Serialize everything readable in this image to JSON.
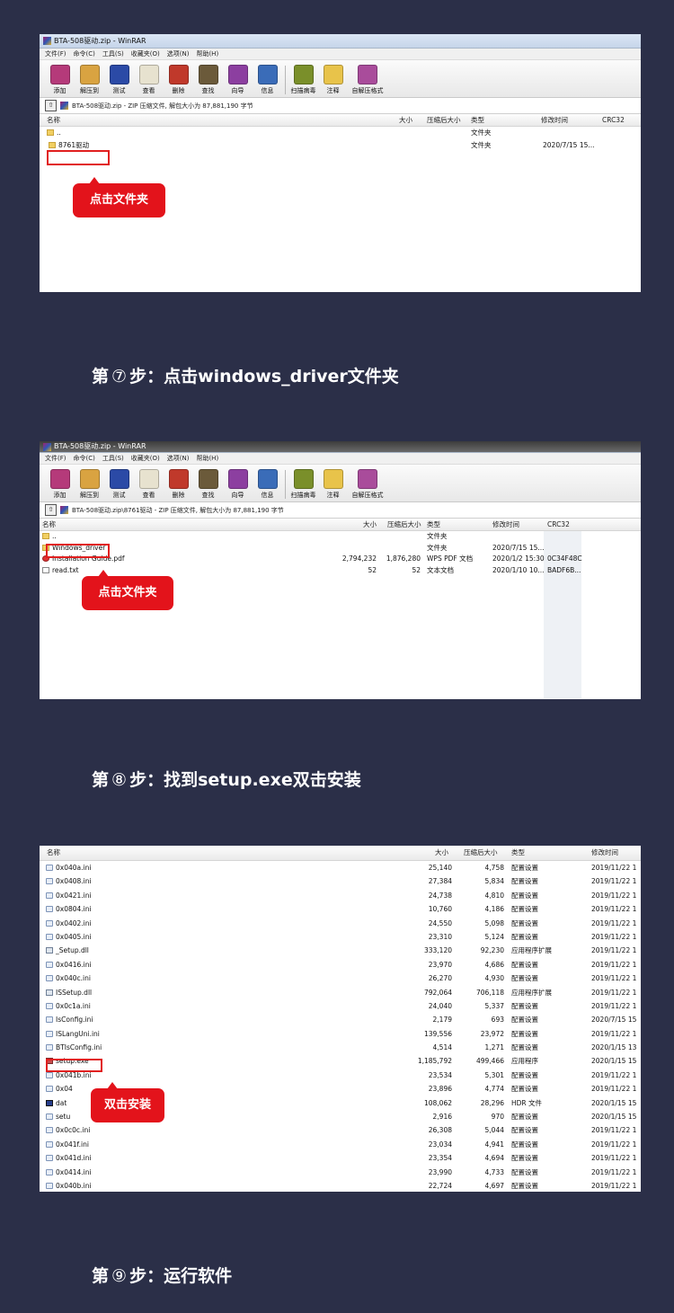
{
  "shot1": {
    "title": "BTA-508驱动.zip - WinRAR",
    "menu": [
      "文件(F)",
      "命令(C)",
      "工具(S)",
      "收藏夹(O)",
      "选项(N)",
      "帮助(H)"
    ],
    "toolbar": [
      "添加",
      "解压到",
      "测试",
      "查看",
      "删除",
      "查找",
      "向导",
      "信息",
      "扫描病毒",
      "注释",
      "自解压格式"
    ],
    "address": "BTA-508驱动.zip - ZIP 压缩文件, 解包大小为 87,881,190 字节",
    "columns": {
      "name": "名称",
      "size": "大小",
      "packed": "压缩后大小",
      "type": "类型",
      "modified": "修改时间",
      "crc": "CRC32"
    },
    "rows": [
      {
        "name": "..",
        "type": "文件夹",
        "modified": ""
      },
      {
        "name": "8761驱动",
        "type": "文件夹",
        "modified": "2020/7/15 15..."
      }
    ],
    "callout": "点击文件夹"
  },
  "step7": {
    "prefix": "第",
    "num": "⑦",
    "text": "步：点击windows_driver文件夹"
  },
  "shot2": {
    "title": "BTA-508驱动.zip - WinRAR",
    "menu": [
      "文件(F)",
      "命令(C)",
      "工具(S)",
      "收藏夹(O)",
      "选项(N)",
      "帮助(H)"
    ],
    "toolbar": [
      "添加",
      "解压到",
      "测试",
      "查看",
      "删除",
      "查找",
      "向导",
      "信息",
      "扫描病毒",
      "注释",
      "自解压格式"
    ],
    "address": "BTA-508驱动.zip\\8761驱动 - ZIP 压缩文件, 解包大小为 87,881,190 字节",
    "columns": {
      "name": "名称",
      "size": "大小",
      "packed": "压缩后大小",
      "type": "类型",
      "modified": "修改时间",
      "crc": "CRC32"
    },
    "rows": [
      {
        "name": "..",
        "size": "",
        "packed": "",
        "type": "文件夹",
        "modified": "",
        "crc": ""
      },
      {
        "name": "Windows_driver",
        "size": "",
        "packed": "",
        "type": "文件夹",
        "modified": "2020/7/15 15...",
        "crc": ""
      },
      {
        "name": "Installation Guide.pdf",
        "size": "2,794,232",
        "packed": "1,876,280",
        "type": "WPS PDF 文档",
        "modified": "2020/1/2 15:30",
        "crc": "0C34F48C"
      },
      {
        "name": "read.txt",
        "size": "52",
        "packed": "52",
        "type": "文本文档",
        "modified": "2020/1/10 10...",
        "crc": "BADF6B..."
      }
    ],
    "callout": "点击文件夹"
  },
  "step8": {
    "prefix": "第",
    "num": "⑧",
    "text": "步：找到setup.exe双击安装"
  },
  "shot3": {
    "columns": {
      "name": "名称",
      "size": "大小",
      "packed": "压缩后大小",
      "type": "类型",
      "modified": "修改时间"
    },
    "rows": [
      {
        "name": "0x040a.ini",
        "size": "25,140",
        "packed": "4,758",
        "type": "配置设置",
        "modified": "2019/11/22 1",
        "icon": "ini"
      },
      {
        "name": "0x0408.ini",
        "size": "27,384",
        "packed": "5,834",
        "type": "配置设置",
        "modified": "2019/11/22 1",
        "icon": "ini"
      },
      {
        "name": "0x0421.ini",
        "size": "24,738",
        "packed": "4,810",
        "type": "配置设置",
        "modified": "2019/11/22 1",
        "icon": "ini"
      },
      {
        "name": "0x0804.ini",
        "size": "10,760",
        "packed": "4,186",
        "type": "配置设置",
        "modified": "2019/11/22 1",
        "icon": "ini"
      },
      {
        "name": "0x0402.ini",
        "size": "24,550",
        "packed": "5,098",
        "type": "配置设置",
        "modified": "2019/11/22 1",
        "icon": "ini"
      },
      {
        "name": "0x0405.ini",
        "size": "23,310",
        "packed": "5,124",
        "type": "配置设置",
        "modified": "2019/11/22 1",
        "icon": "ini"
      },
      {
        "name": "_Setup.dll",
        "size": "333,120",
        "packed": "92,230",
        "type": "应用程序扩展",
        "modified": "2019/11/22 1",
        "icon": "dll"
      },
      {
        "name": "0x0416.ini",
        "size": "23,970",
        "packed": "4,686",
        "type": "配置设置",
        "modified": "2019/11/22 1",
        "icon": "ini"
      },
      {
        "name": "0x040c.ini",
        "size": "26,270",
        "packed": "4,930",
        "type": "配置设置",
        "modified": "2019/11/22 1",
        "icon": "ini"
      },
      {
        "name": "ISSetup.dll",
        "size": "792,064",
        "packed": "706,118",
        "type": "应用程序扩展",
        "modified": "2019/11/22 1",
        "icon": "dll"
      },
      {
        "name": "0x0c1a.ini",
        "size": "24,040",
        "packed": "5,337",
        "type": "配置设置",
        "modified": "2019/11/22 1",
        "icon": "ini"
      },
      {
        "name": "IsConfig.ini",
        "size": "2,179",
        "packed": "693",
        "type": "配置设置",
        "modified": "2020/7/15 15",
        "icon": "ini"
      },
      {
        "name": "ISLangUni.ini",
        "size": "139,556",
        "packed": "23,972",
        "type": "配置设置",
        "modified": "2019/11/22 1",
        "icon": "ini"
      },
      {
        "name": "BTIsConfig.ini",
        "size": "4,514",
        "packed": "1,271",
        "type": "配置设置",
        "modified": "2020/1/15 13",
        "icon": "ini"
      },
      {
        "name": "setup.exe",
        "size": "1,185,792",
        "packed": "499,466",
        "type": "应用程序",
        "modified": "2020/1/15 15",
        "icon": "exe"
      },
      {
        "name": "0x041b.ini",
        "size": "23,534",
        "packed": "5,301",
        "type": "配置设置",
        "modified": "2019/11/22 1",
        "icon": "ini"
      },
      {
        "name": "0x04",
        "size": "23,896",
        "packed": "4,774",
        "type": "配置设置",
        "modified": "2019/11/22 1",
        "icon": "ini"
      },
      {
        "name": "dat",
        "size": "108,062",
        "packed": "28,296",
        "type": "HDR 文件",
        "modified": "2020/1/15 15",
        "icon": "img"
      },
      {
        "name": "setu",
        "size": "2,916",
        "packed": "970",
        "type": "配置设置",
        "modified": "2020/1/15 15",
        "icon": "ini"
      },
      {
        "name": "0x0c0c.ini",
        "size": "26,308",
        "packed": "5,044",
        "type": "配置设置",
        "modified": "2019/11/22 1",
        "icon": "ini"
      },
      {
        "name": "0x041f.ini",
        "size": "23,034",
        "packed": "4,941",
        "type": "配置设置",
        "modified": "2019/11/22 1",
        "icon": "ini"
      },
      {
        "name": "0x041d.ini",
        "size": "23,354",
        "packed": "4,694",
        "type": "配置设置",
        "modified": "2019/11/22 1",
        "icon": "ini"
      },
      {
        "name": "0x0414.ini",
        "size": "23,990",
        "packed": "4,733",
        "type": "配置设置",
        "modified": "2019/11/22 1",
        "icon": "ini"
      },
      {
        "name": "0x040b.ini",
        "size": "22,724",
        "packed": "4,697",
        "type": "配置设置",
        "modified": "2019/11/22 1",
        "icon": "ini"
      }
    ],
    "callout": "双击安装"
  },
  "step9": {
    "prefix": "第",
    "num": "⑨",
    "text": "步：运行软件"
  },
  "toolbar_icon_colors": [
    "#b53a7a",
    "#d9a341",
    "#2b4aa6",
    "#e7e2cf",
    "#c0392b",
    "#6b5a3a",
    "#8c3fa0",
    "#3a6cb8",
    "#7a8f2a",
    "#e8c34a",
    "#a94c9b"
  ]
}
